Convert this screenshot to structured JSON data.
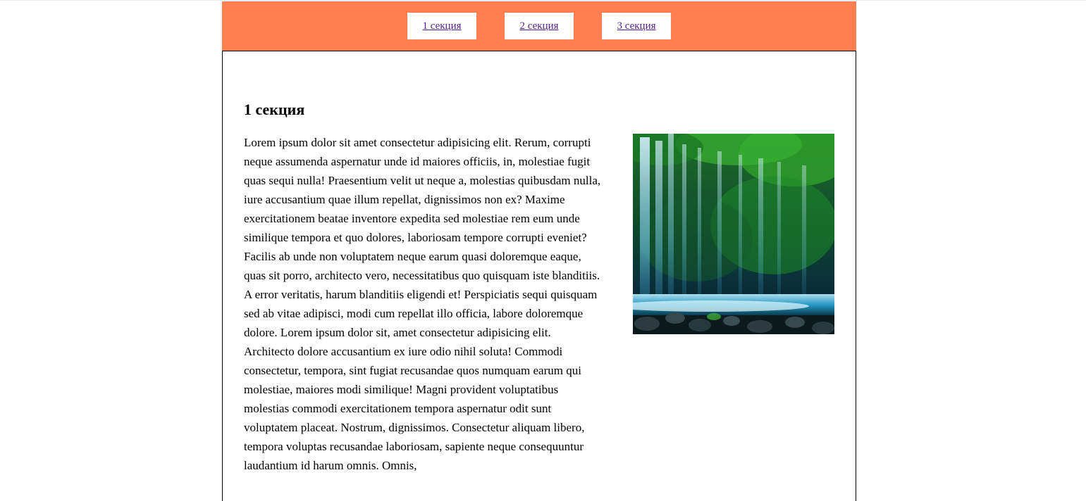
{
  "nav": {
    "items": [
      {
        "label": "1 секция"
      },
      {
        "label": "2 секция"
      },
      {
        "label": "3 секция"
      }
    ],
    "background": "#ff7f50"
  },
  "section": {
    "title": "1 секция",
    "text": "Lorem ipsum dolor sit amet consectetur adipisicing elit. Rerum, corrupti neque assumenda aspernatur unde id maiores officiis, in, molestiae fugit quas sequi nulla! Praesentium velit ut neque a, molestias quibusdam nulla, iure accusantium quae illum repellat, dignissimos non ex? Maxime exercitationem beatae inventore expedita sed molestiae rem eum unde similique tempora et quo dolores, laboriosam tempore corrupti eveniet? Facilis ab unde non voluptatem neque earum quasi doloremque eaque, quas sit porro, architecto vero, necessitatibus quo quisquam iste blanditiis. A error veritatis, harum blanditiis eligendi et! Perspiciatis sequi quisquam sed ab vitae adipisci, modi cum repellat illo officia, labore doloremque dolore. Lorem ipsum dolor sit, amet consectetur adipisicing elit. Architecto dolore accusantium ex iure odio nihil soluta! Commodi consectetur, tempora, sint fugiat recusandae quos numquam earum qui molestiae, maiores modi similique! Magni provident voluptatibus molestias commodi exercitationem tempora aspernatur odit sunt voluptatem placeat. Nostrum, dignissimos. Consectetur aliquam libero, tempora voluptas recusandae laboriosam, sapiente neque consequuntur laudantium id harum omnis. Omnis,",
    "image": {
      "icon": "waterfall-image"
    }
  }
}
